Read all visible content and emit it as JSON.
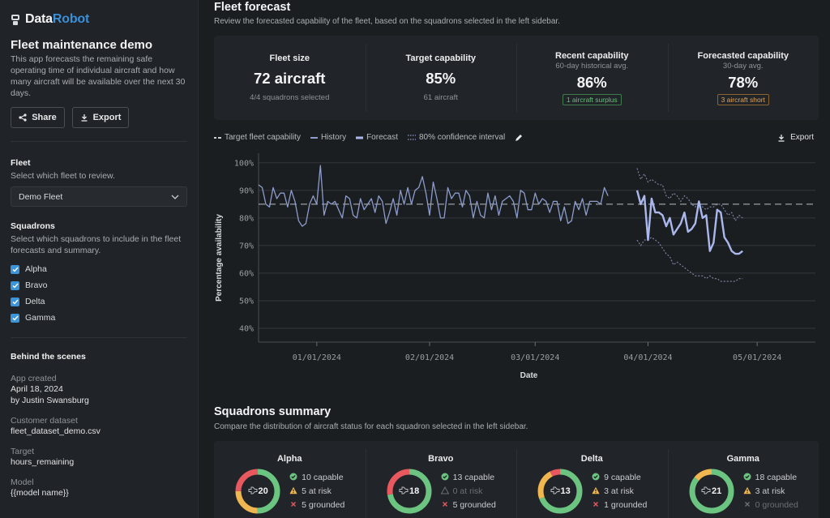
{
  "brand": {
    "part1": "Data",
    "part2": "Robot"
  },
  "sidebar": {
    "title": "Fleet maintenance demo",
    "description": "This app forecasts the remaining safe operating time of individual aircraft and how many aircraft will be available over the next 30 days.",
    "share_label": "Share",
    "export_label": "Export",
    "fleet": {
      "label": "Fleet",
      "hint": "Select which fleet to review.",
      "selected": "Demo Fleet"
    },
    "squadrons": {
      "label": "Squadrons",
      "hint": "Select which squadrons to include in the fleet forecasts and summary.",
      "items": [
        {
          "label": "Alpha",
          "checked": true
        },
        {
          "label": "Bravo",
          "checked": true
        },
        {
          "label": "Delta",
          "checked": true
        },
        {
          "label": "Gamma",
          "checked": true
        }
      ]
    },
    "behind": {
      "title": "Behind the scenes",
      "app_created_label": "App created",
      "app_created_date": "April 18, 2024",
      "app_created_by": "by Justin Swansburg",
      "dataset_label": "Customer dataset",
      "dataset_value": "fleet_dataset_demo.csv",
      "target_label": "Target",
      "target_value": "hours_remaining",
      "model_label": "Model",
      "model_value": "{{model name}}"
    }
  },
  "forecast": {
    "title": "Fleet forecast",
    "subtitle": "Review the forecasted capability of the fleet, based on the squadrons selected in the left sidebar.",
    "kpis": [
      {
        "title": "Fleet size",
        "value": "72 aircraft",
        "foot": "4/4 squadrons selected"
      },
      {
        "title": "Target capability",
        "value": "85%",
        "foot": "61 aircraft"
      },
      {
        "title": "Recent capability",
        "hint": "60-day historical avg.",
        "value": "86%",
        "badge": "1 aircraft surplus"
      },
      {
        "title": "Forecasted capability",
        "hint": "30-day avg.",
        "value": "78%",
        "badge": "3 aircraft short"
      }
    ],
    "legend": {
      "target": "Target fleet capability",
      "history": "History",
      "forecast": "Forecast",
      "ci": "80% confidence interval"
    },
    "export_label": "Export"
  },
  "chart_data": {
    "type": "line",
    "xlabel": "Date",
    "ylabel": "Percentage availability",
    "ylim": [
      35,
      102
    ],
    "yticks": [
      "100%",
      "90%",
      "80%",
      "70%",
      "60%",
      "50%",
      "40%"
    ],
    "ytick_values": [
      100,
      90,
      80,
      70,
      60,
      50,
      40
    ],
    "xticks": [
      "01/01/2024",
      "02/01/2024",
      "03/01/2024",
      "04/01/2024",
      "05/01/2024"
    ],
    "xtick_days": [
      0,
      31,
      60,
      91,
      121
    ],
    "xlim_days": [
      -16,
      137
    ],
    "target": 85,
    "colors": {
      "history": "#8c9ccc",
      "forecast": "#aab8ee",
      "ci": "#7f8aa8",
      "target": "#9a9ea3"
    },
    "history_start_day": -16,
    "history": [
      92,
      91,
      85,
      84,
      91,
      87,
      89,
      89,
      84,
      90,
      86,
      79,
      77,
      78,
      85,
      88,
      85,
      99,
      81,
      86,
      85,
      86,
      83,
      80,
      88,
      87,
      81,
      80,
      87,
      83,
      85,
      87,
      82,
      88,
      86,
      78,
      82,
      87,
      81,
      90,
      85,
      91,
      85,
      90,
      91,
      95,
      89,
      81,
      93,
      87,
      80,
      80,
      91,
      87,
      89,
      89,
      84,
      90,
      88,
      80,
      86,
      81,
      80,
      89,
      83,
      88,
      81,
      86,
      87,
      88,
      86,
      80,
      90,
      89,
      83,
      83,
      89,
      85,
      87,
      86,
      82,
      86,
      86,
      79,
      84,
      78,
      79,
      86,
      83,
      87,
      81,
      86,
      86,
      86,
      85,
      91,
      88
    ],
    "forecast_start_day": 88,
    "forecast": [
      90,
      85,
      88,
      72,
      87,
      82,
      82,
      81,
      77,
      80,
      74,
      76,
      78,
      82,
      75,
      76,
      78,
      86,
      80,
      81,
      68,
      71,
      83,
      82,
      73,
      71,
      68,
      67,
      67,
      68
    ],
    "ci_upper": [
      98,
      94,
      96,
      93,
      94,
      93,
      92,
      92,
      88,
      87,
      89,
      88,
      86,
      88,
      87,
      85,
      84,
      86,
      84,
      83,
      84,
      84,
      85,
      85,
      83,
      81,
      82,
      79,
      81,
      80
    ],
    "ci_lower": [
      72,
      70,
      72,
      72,
      73,
      72,
      71,
      69,
      67,
      66,
      63,
      64,
      63,
      62,
      61,
      60,
      59,
      59,
      59,
      58,
      59,
      58,
      58,
      57,
      57,
      57,
      57,
      57,
      58,
      58
    ]
  },
  "summary": {
    "title": "Squadrons summary",
    "subtitle": "Compare the distribution of aircraft status for each squadron selected in the left sidebar.",
    "colors": {
      "capable": "#6cc481",
      "at_risk": "#f0b64f",
      "grounded": "#e8585f"
    },
    "squadrons": [
      {
        "name": "Alpha",
        "total": "20",
        "capable": 10,
        "at_risk": 5,
        "grounded": 5,
        "capable_label": "10 capable",
        "at_risk_label": "5 at risk",
        "grounded_label": "5 grounded"
      },
      {
        "name": "Bravo",
        "total": "18",
        "capable": 13,
        "at_risk": 0,
        "grounded": 5,
        "capable_label": "13 capable",
        "at_risk_label": "0 at risk",
        "grounded_label": "5 grounded"
      },
      {
        "name": "Delta",
        "total": "13",
        "capable": 9,
        "at_risk": 3,
        "grounded": 1,
        "capable_label": "9 capable",
        "at_risk_label": "3 at risk",
        "grounded_label": "1 grounded"
      },
      {
        "name": "Gamma",
        "total": "21",
        "capable": 18,
        "at_risk": 3,
        "grounded": 0,
        "capable_label": "18 capable",
        "at_risk_label": "3 at risk",
        "grounded_label": "0 grounded"
      }
    ]
  }
}
